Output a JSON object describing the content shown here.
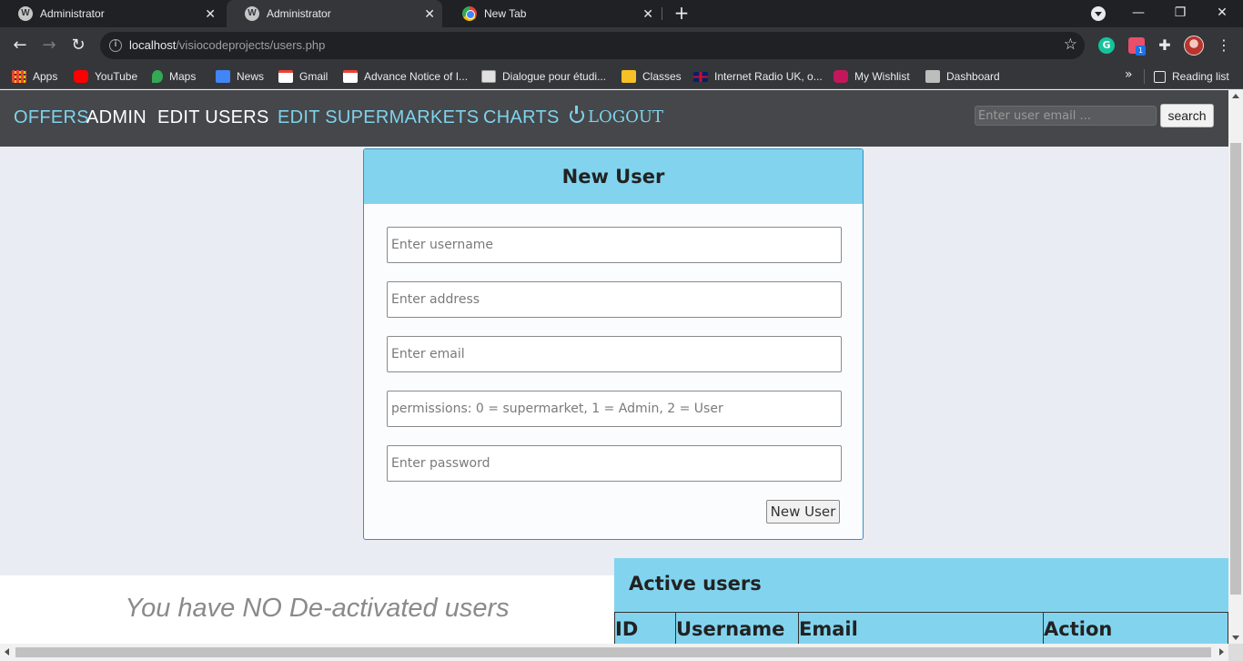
{
  "browser": {
    "tabs": [
      {
        "title": "Administrator",
        "icon": "wordpress-icon",
        "active": false
      },
      {
        "title": "Administrator",
        "icon": "wordpress-icon",
        "active": true
      },
      {
        "title": "New Tab",
        "icon": "chrome-icon",
        "active": false
      }
    ],
    "close_glyph": "✕",
    "new_tab_glyph": "+",
    "window_controls": {
      "minimize": "—",
      "restore": "❐",
      "close": "✕"
    },
    "url_host": "localhost",
    "url_path": "/visiocodeprojects/users.php",
    "extensions": {
      "grammarly_letter": "G",
      "todo_badge": "1"
    },
    "bookmarks": [
      {
        "label": "Apps",
        "icon": "apps-grid-icon",
        "color": "#e94235"
      },
      {
        "label": "YouTube",
        "icon": "youtube-icon",
        "color": "#ff0000"
      },
      {
        "label": "Maps",
        "icon": "maps-pin-icon",
        "color": "#34a853"
      },
      {
        "label": "News",
        "icon": "google-news-icon",
        "color": "#4285f4"
      },
      {
        "label": "Gmail",
        "icon": "gmail-icon",
        "color": "#ea4335"
      },
      {
        "label": "Advance Notice of I...",
        "icon": "gmail-icon",
        "color": "#ea4335"
      },
      {
        "label": "Dialogue pour étudi...",
        "icon": "document-icon",
        "color": "#c9c9c9"
      },
      {
        "label": "Classes",
        "icon": "google-classroom-icon",
        "color": "#f6c026"
      },
      {
        "label": "Internet Radio UK, o...",
        "icon": "uk-flag-icon",
        "color": "#c8102e"
      },
      {
        "label": "My Wishlist",
        "icon": "wishlist-q-icon",
        "color": "#c2185b"
      },
      {
        "label": "Dashboard",
        "icon": "dashboard-page-icon",
        "color": "#bdbdbd"
      }
    ],
    "bookmarks_more": "»",
    "reading_list": "Reading list"
  },
  "site_nav": {
    "offers": "OFFERS",
    "admin": "ADMIN",
    "edit_users": "EDIT USERS",
    "edit_supermarkets": "EDIT SUPERMARKETS",
    "charts": "CHARTS",
    "logout": "LOGOUT",
    "search_placeholder": "Enter user email ...",
    "search_button": "search",
    "accent_color": "#7dd3ec"
  },
  "new_user_form": {
    "title": "New User",
    "username_placeholder": "Enter username",
    "address_placeholder": "Enter address",
    "email_placeholder": "Enter email",
    "permissions_placeholder": "permissions: 0 = supermarket, 1 = Admin, 2 = User",
    "password_placeholder": "Enter password",
    "submit_label": "New User",
    "header_color": "#82d4ee"
  },
  "deactivated": {
    "message": "You have NO De-activated users"
  },
  "active_users": {
    "title": "Active users",
    "columns": [
      "ID",
      "Username",
      "Email",
      "Action"
    ]
  }
}
